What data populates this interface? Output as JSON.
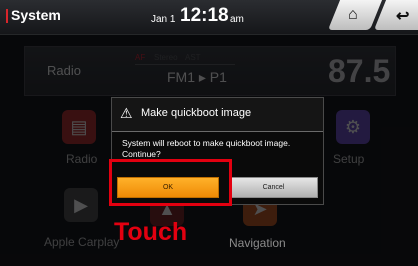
{
  "topbar": {
    "title": "System",
    "date": "Jan 1",
    "time": "12:18",
    "ampm": "am",
    "home_icon": "home-icon",
    "back_icon": "back-arrow-icon"
  },
  "radio": {
    "label": "Radio",
    "af": "AF",
    "stereo": "Stereo",
    "ast": "AST",
    "band": "FM1 ▸ P1",
    "frequency": "87.5"
  },
  "apps": {
    "radio_label": "Radio",
    "setup_label": "Setup",
    "carplay_label": "Apple Carplay",
    "navigation_label": "Navigation"
  },
  "dialog": {
    "title": "Make quickboot image",
    "message": "System will reboot to make quickboot image. Continue?",
    "ok_label": "OK",
    "cancel_label": "Cancel"
  },
  "annotation": {
    "touch_label": "Touch"
  },
  "colors": {
    "accent_red": "#e30010",
    "ok_orange": "#f39a10",
    "setup_purple": "#6a49c8"
  }
}
